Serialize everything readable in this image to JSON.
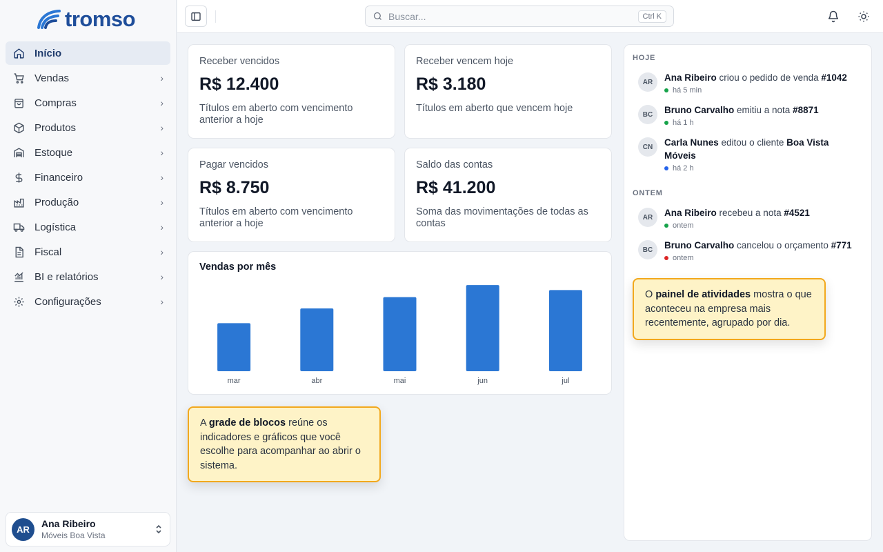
{
  "brand": {
    "name": "tromso"
  },
  "sidebar": {
    "items": [
      {
        "label": "Início",
        "icon": "home-icon",
        "active": true
      },
      {
        "label": "Vendas",
        "icon": "cart-icon"
      },
      {
        "label": "Compras",
        "icon": "bag-icon"
      },
      {
        "label": "Produtos",
        "icon": "box-icon"
      },
      {
        "label": "Estoque",
        "icon": "warehouse-icon"
      },
      {
        "label": "Financeiro",
        "icon": "dollar-icon"
      },
      {
        "label": "Produção",
        "icon": "factory-icon"
      },
      {
        "label": "Logística",
        "icon": "truck-icon"
      },
      {
        "label": "Fiscal",
        "icon": "document-icon"
      },
      {
        "label": "BI e relatórios",
        "icon": "chart-icon"
      },
      {
        "label": "Configurações",
        "icon": "gear-icon"
      }
    ]
  },
  "user": {
    "initials": "AR",
    "name": "Ana Ribeiro",
    "company": "Móveis Boa Vista"
  },
  "topbar": {
    "search_placeholder": "Buscar...",
    "shortcut": "Ctrl K"
  },
  "kpis": [
    {
      "title": "Receber vencidos",
      "value": "R$ 12.400",
      "desc": "Títulos em aberto com vencimento anterior a hoje"
    },
    {
      "title": "Receber vencem hoje",
      "value": "R$ 3.180",
      "desc": "Títulos em aberto que vencem hoje"
    },
    {
      "title": "Pagar vencidos",
      "value": "R$ 8.750",
      "desc": "Títulos em aberto com vencimento anterior a hoje"
    },
    {
      "title": "Saldo das contas",
      "value": "R$ 41.200",
      "desc": "Soma das movimentações de todas as contas"
    }
  ],
  "chart_data": {
    "type": "bar",
    "title": "Vendas por mês",
    "categories": [
      "mar",
      "abr",
      "mai",
      "jun",
      "jul"
    ],
    "values": [
      68,
      89,
      105,
      122,
      115
    ],
    "ylim": [
      0,
      130
    ],
    "grid": false,
    "color": "#2b77d4"
  },
  "activity": {
    "sections": [
      {
        "label": "HOJE",
        "items": [
          {
            "initials": "AR",
            "actor": "Ana Ribeiro",
            "action": " criou o pedido de venda ",
            "object": "#1042",
            "time": "há 5 min",
            "dot": "#16a34a"
          },
          {
            "initials": "BC",
            "actor": "Bruno Carvalho",
            "action": " emitiu a nota ",
            "object": "#8871",
            "time": "há 1 h",
            "dot": "#16a34a"
          },
          {
            "initials": "CN",
            "actor": "Carla Nunes",
            "action": " editou o cliente ",
            "object": "Boa Vista Móveis",
            "time": "há 2 h",
            "dot": "#2563eb"
          }
        ]
      },
      {
        "label": "ONTEM",
        "items": [
          {
            "initials": "AR",
            "actor": "Ana Ribeiro",
            "action": " recebeu a nota ",
            "object": "#4521",
            "time": "ontem",
            "dot": "#16a34a"
          },
          {
            "initials": "BC",
            "actor": "Bruno Carvalho",
            "action": " cancelou o orçamento ",
            "object": "#771",
            "time": "ontem",
            "dot": "#dc2626"
          }
        ]
      }
    ]
  },
  "tips": {
    "grid": {
      "pre": "A ",
      "bold": "grade de blocos",
      "post": " reúne os indicadores e gráficos que você escolhe para acompanhar ao abrir o sistema."
    },
    "activity": {
      "pre": "O ",
      "bold": "painel de atividades",
      "post": " mostra o que aconteceu na empresa mais recentemente, agrupado por dia."
    }
  }
}
